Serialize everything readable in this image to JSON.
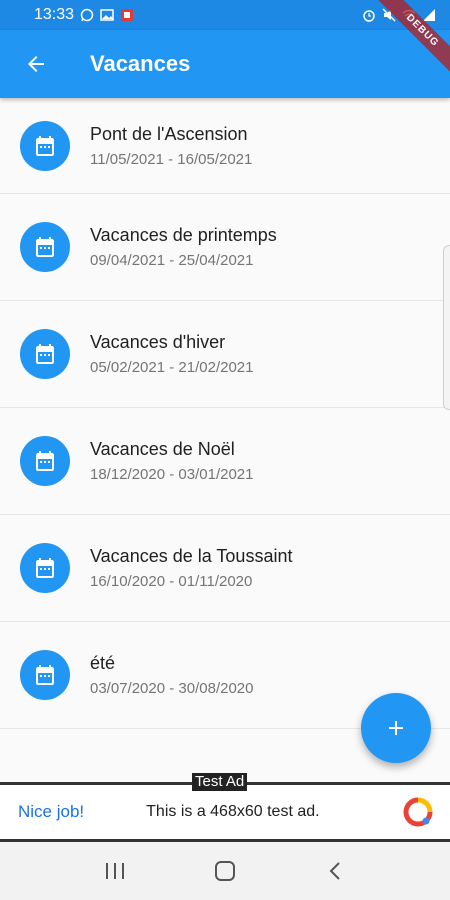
{
  "status_bar": {
    "time": "13:33"
  },
  "app_bar": {
    "title": "Vacances",
    "back_icon": "arrow-back-icon"
  },
  "debug_banner": "DEBUG",
  "holidays": [
    {
      "title": "Pont de l'Ascension",
      "dates": "11/05/2021 - 16/05/2021"
    },
    {
      "title": "Vacances de printemps",
      "dates": "09/04/2021 - 25/04/2021"
    },
    {
      "title": "Vacances d'hiver",
      "dates": "05/02/2021 - 21/02/2021"
    },
    {
      "title": "Vacances de Noël",
      "dates": "18/12/2020 - 03/01/2021"
    },
    {
      "title": "Vacances de la Toussaint",
      "dates": "16/10/2020 - 01/11/2020"
    },
    {
      "title": "été",
      "dates": "03/07/2020 - 30/08/2020"
    }
  ],
  "fab": {
    "icon": "plus-icon"
  },
  "ad": {
    "label": "Test Ad",
    "title": "Nice job!",
    "text": "This is a 468x60 test ad."
  },
  "colors": {
    "primary": "#2196f3",
    "status_bar": "#1e88e5",
    "ad_link": "#1a73e8"
  }
}
